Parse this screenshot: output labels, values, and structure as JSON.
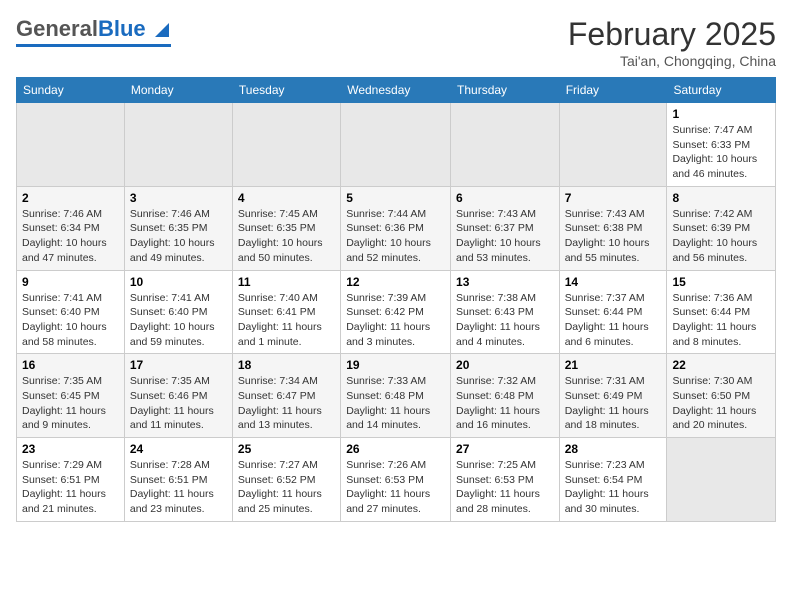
{
  "header": {
    "logo_general": "General",
    "logo_blue": "Blue",
    "title": "February 2025",
    "location": "Tai'an, Chongqing, China"
  },
  "days_of_week": [
    "Sunday",
    "Monday",
    "Tuesday",
    "Wednesday",
    "Thursday",
    "Friday",
    "Saturday"
  ],
  "weeks": [
    [
      {
        "day": "",
        "info": ""
      },
      {
        "day": "",
        "info": ""
      },
      {
        "day": "",
        "info": ""
      },
      {
        "day": "",
        "info": ""
      },
      {
        "day": "",
        "info": ""
      },
      {
        "day": "",
        "info": ""
      },
      {
        "day": "1",
        "info": "Sunrise: 7:47 AM\nSunset: 6:33 PM\nDaylight: 10 hours and 46 minutes."
      }
    ],
    [
      {
        "day": "2",
        "info": "Sunrise: 7:46 AM\nSunset: 6:34 PM\nDaylight: 10 hours and 47 minutes."
      },
      {
        "day": "3",
        "info": "Sunrise: 7:46 AM\nSunset: 6:35 PM\nDaylight: 10 hours and 49 minutes."
      },
      {
        "day": "4",
        "info": "Sunrise: 7:45 AM\nSunset: 6:35 PM\nDaylight: 10 hours and 50 minutes."
      },
      {
        "day": "5",
        "info": "Sunrise: 7:44 AM\nSunset: 6:36 PM\nDaylight: 10 hours and 52 minutes."
      },
      {
        "day": "6",
        "info": "Sunrise: 7:43 AM\nSunset: 6:37 PM\nDaylight: 10 hours and 53 minutes."
      },
      {
        "day": "7",
        "info": "Sunrise: 7:43 AM\nSunset: 6:38 PM\nDaylight: 10 hours and 55 minutes."
      },
      {
        "day": "8",
        "info": "Sunrise: 7:42 AM\nSunset: 6:39 PM\nDaylight: 10 hours and 56 minutes."
      }
    ],
    [
      {
        "day": "9",
        "info": "Sunrise: 7:41 AM\nSunset: 6:40 PM\nDaylight: 10 hours and 58 minutes."
      },
      {
        "day": "10",
        "info": "Sunrise: 7:41 AM\nSunset: 6:40 PM\nDaylight: 10 hours and 59 minutes."
      },
      {
        "day": "11",
        "info": "Sunrise: 7:40 AM\nSunset: 6:41 PM\nDaylight: 11 hours and 1 minute."
      },
      {
        "day": "12",
        "info": "Sunrise: 7:39 AM\nSunset: 6:42 PM\nDaylight: 11 hours and 3 minutes."
      },
      {
        "day": "13",
        "info": "Sunrise: 7:38 AM\nSunset: 6:43 PM\nDaylight: 11 hours and 4 minutes."
      },
      {
        "day": "14",
        "info": "Sunrise: 7:37 AM\nSunset: 6:44 PM\nDaylight: 11 hours and 6 minutes."
      },
      {
        "day": "15",
        "info": "Sunrise: 7:36 AM\nSunset: 6:44 PM\nDaylight: 11 hours and 8 minutes."
      }
    ],
    [
      {
        "day": "16",
        "info": "Sunrise: 7:35 AM\nSunset: 6:45 PM\nDaylight: 11 hours and 9 minutes."
      },
      {
        "day": "17",
        "info": "Sunrise: 7:35 AM\nSunset: 6:46 PM\nDaylight: 11 hours and 11 minutes."
      },
      {
        "day": "18",
        "info": "Sunrise: 7:34 AM\nSunset: 6:47 PM\nDaylight: 11 hours and 13 minutes."
      },
      {
        "day": "19",
        "info": "Sunrise: 7:33 AM\nSunset: 6:48 PM\nDaylight: 11 hours and 14 minutes."
      },
      {
        "day": "20",
        "info": "Sunrise: 7:32 AM\nSunset: 6:48 PM\nDaylight: 11 hours and 16 minutes."
      },
      {
        "day": "21",
        "info": "Sunrise: 7:31 AM\nSunset: 6:49 PM\nDaylight: 11 hours and 18 minutes."
      },
      {
        "day": "22",
        "info": "Sunrise: 7:30 AM\nSunset: 6:50 PM\nDaylight: 11 hours and 20 minutes."
      }
    ],
    [
      {
        "day": "23",
        "info": "Sunrise: 7:29 AM\nSunset: 6:51 PM\nDaylight: 11 hours and 21 minutes."
      },
      {
        "day": "24",
        "info": "Sunrise: 7:28 AM\nSunset: 6:51 PM\nDaylight: 11 hours and 23 minutes."
      },
      {
        "day": "25",
        "info": "Sunrise: 7:27 AM\nSunset: 6:52 PM\nDaylight: 11 hours and 25 minutes."
      },
      {
        "day": "26",
        "info": "Sunrise: 7:26 AM\nSunset: 6:53 PM\nDaylight: 11 hours and 27 minutes."
      },
      {
        "day": "27",
        "info": "Sunrise: 7:25 AM\nSunset: 6:53 PM\nDaylight: 11 hours and 28 minutes."
      },
      {
        "day": "28",
        "info": "Sunrise: 7:23 AM\nSunset: 6:54 PM\nDaylight: 11 hours and 30 minutes."
      },
      {
        "day": "",
        "info": ""
      }
    ]
  ]
}
